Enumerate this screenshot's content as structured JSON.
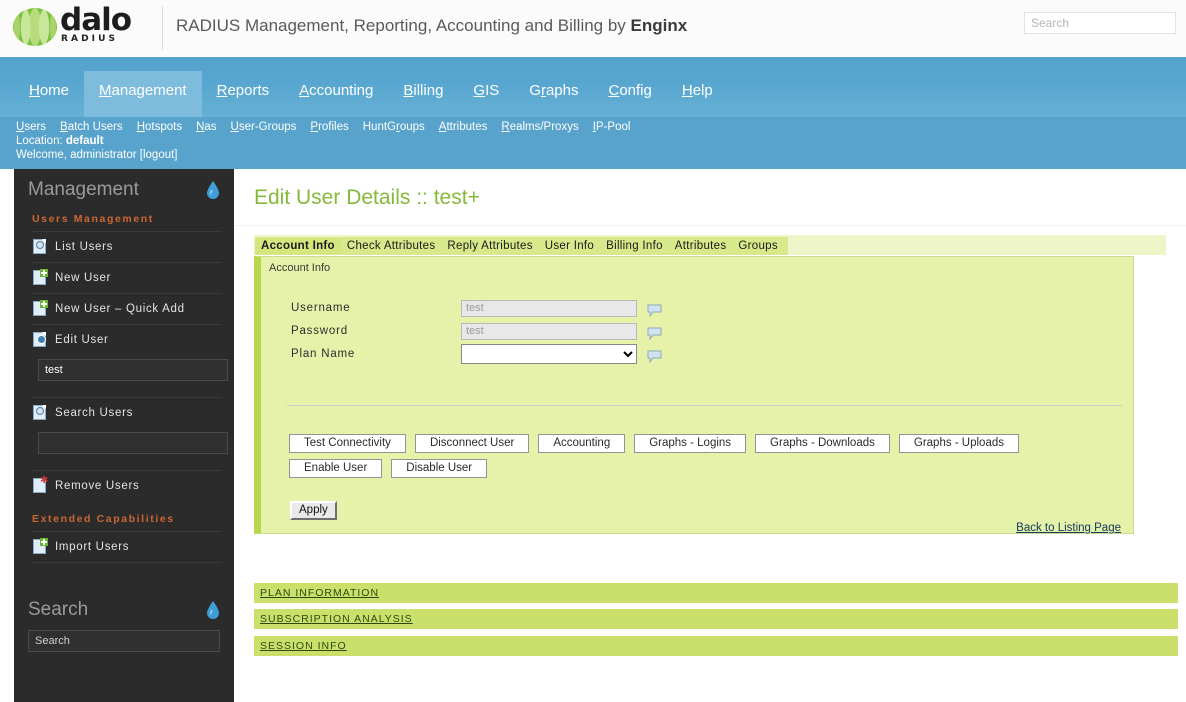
{
  "header": {
    "logo_name": "dalo",
    "logo_sub": "RADIUS",
    "title_main": "RADIUS Management, Reporting, Accounting and Billing by ",
    "title_brand": "Enginx",
    "search_placeholder": "Search",
    "search_value": ""
  },
  "mainnav": {
    "items": [
      {
        "label": "Home",
        "accesskey": "H",
        "active": false
      },
      {
        "label": "Management",
        "accesskey": "M",
        "active": true
      },
      {
        "label": "Reports",
        "accesskey": "R",
        "active": false
      },
      {
        "label": "Accounting",
        "accesskey": "A",
        "active": false
      },
      {
        "label": "Billing",
        "accesskey": "B",
        "active": false
      },
      {
        "label": "GIS",
        "accesskey": "G",
        "active": false
      },
      {
        "label": "Graphs",
        "accesskey": "G",
        "active": false
      },
      {
        "label": "Config",
        "accesskey": "C",
        "active": false
      },
      {
        "label": "Help",
        "accesskey": "H",
        "active": false
      }
    ]
  },
  "subnav": {
    "items": [
      "Users",
      "Batch Users",
      "Hotspots",
      "Nas",
      "User-Groups",
      "Profiles",
      "HuntGroups",
      "Attributes",
      "Realms/Proxys",
      "IP-Pool"
    ],
    "location_label": "Location: ",
    "location_value": "default",
    "welcome": "Welcome, administrator   [logout]"
  },
  "sidebar": {
    "title": "Management",
    "section1": "Users Management",
    "items": [
      {
        "label": "List Users",
        "icon": "list-users-icon"
      },
      {
        "label": "New User",
        "icon": "new-user-icon"
      },
      {
        "label": "New User – Quick Add",
        "icon": "new-user-quick-add-icon"
      },
      {
        "label": "Edit User",
        "icon": "edit-user-icon"
      }
    ],
    "edit_user_value": "test",
    "search_users_label": "Search Users",
    "search_users_value": "",
    "remove_users_label": "Remove Users",
    "section2": "Extended Capabilities",
    "import_users_label": "Import Users",
    "search_title": "Search",
    "search_placeholder": "Search",
    "search_value": ""
  },
  "main": {
    "page_title": "Edit User Details :: test+",
    "tabs": [
      {
        "label": "Account Info",
        "active": true
      },
      {
        "label": "Check Attributes",
        "active": false
      },
      {
        "label": "Reply Attributes",
        "active": false
      },
      {
        "label": "User Info",
        "active": false
      },
      {
        "label": "Billing Info",
        "active": false
      },
      {
        "label": "Attributes",
        "active": false
      },
      {
        "label": "Groups",
        "active": false
      }
    ],
    "panel_legend": "Account Info",
    "fields": [
      {
        "label": "Username",
        "value": "test",
        "type": "text"
      },
      {
        "label": "Password",
        "value": "test",
        "type": "text"
      },
      {
        "label": "Plan Name",
        "value": "",
        "type": "select"
      }
    ],
    "buttons_row1": [
      "Test Connectivity",
      "Disconnect User",
      "Accounting",
      "Graphs - Logins",
      "Graphs - Downloads",
      "Graphs - Uploads"
    ],
    "buttons_row2": [
      "Enable User",
      "Disable User"
    ],
    "apply_label": "Apply",
    "back_link": "Back to Listing Page",
    "accordions": [
      "PLAN INFORMATION",
      "SUBSCRIPTION ANALYSIS",
      "SESSION INFO"
    ]
  },
  "colors": {
    "nav_blue": "#57a3cb",
    "nav_active": "#7dbcdd",
    "sidebar_bg": "#2b2b2b",
    "accent_orange": "#cc6633",
    "panel_green": "#e6f2a9",
    "accordion_green": "#cbe06b",
    "title_green": "#86b83b",
    "logo_green": "#8cc63e"
  }
}
